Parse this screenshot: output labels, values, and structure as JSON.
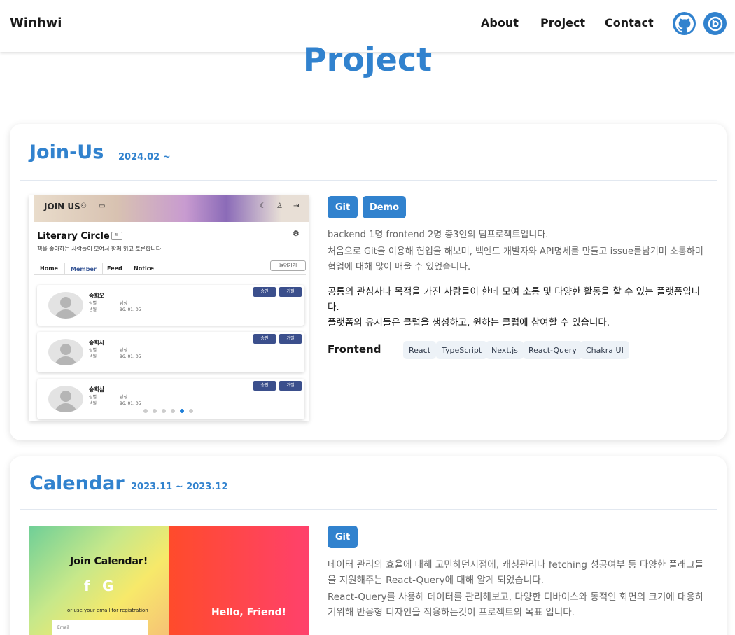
{
  "header": {
    "brand": "Winhwi",
    "nav": [
      "About",
      "Project",
      "Contact"
    ],
    "icons": [
      "github-icon",
      "blog-icon"
    ],
    "accent": "#3182ce"
  },
  "page_title": "Project",
  "projects": [
    {
      "title": "Join-Us",
      "date": "2024.02 ~",
      "buttons": [
        "Git",
        "Demo"
      ],
      "desc_gray": [
        "backend 1명 frontend 2명 총3인의 팀프로젝트입니다.",
        "처음으로 Git을 이용해 협업을 해보며, 백엔드 개발자와 API명세를 만들고 issue를남기며 소통하며 협업에 대해 많이 배울 수 있었습니다."
      ],
      "desc_dark": [
        "공통의 관심사나 목적을 가진 사람들이 한데 모여 소통 및 다양한 활동을 할 수 있는 플랫폼입니다.",
        "플랫폼의 유저들은 클럽을 생성하고, 원하는 클럽에 참여할 수 있습니다."
      ],
      "stack_label": "Frontend",
      "stack": [
        "React",
        "TypeScript",
        "Next.js",
        "React-Query",
        "Chakra UI"
      ],
      "screenshot": {
        "logo": "JOIN US",
        "title": "Literary Circle",
        "badge": "독",
        "subtitle": "책을 좋아하는 사람들이 모여서 함께 읽고 토론합니다.",
        "tabs": [
          "Home",
          "Member",
          "Feed",
          "Notice"
        ],
        "join_button": "들어가기",
        "members": [
          {
            "name": "송회오",
            "gender_label": "성별",
            "gender": "남성",
            "birth_label": "생일",
            "birth": "96. 01. 05"
          },
          {
            "name": "송회사",
            "gender_label": "성별",
            "gender": "남성",
            "birth_label": "생일",
            "birth": "96. 01. 05"
          },
          {
            "name": "송회삼",
            "gender_label": "성별",
            "gender": "남성",
            "birth_label": "생일",
            "birth": "96. 01. 05"
          }
        ],
        "approve": "승인",
        "reject": "거절",
        "carousel_active": 5,
        "carousel_total": 6
      }
    },
    {
      "title": "Calendar",
      "date": "2023.11 ~ 2023.12",
      "buttons": [
        "Git"
      ],
      "desc_gray": [
        "데이터 관리의 효율에 대해 고민하던시점에, 캐싱관리나 fetching 성공여부 등 다양한 플래그들을 지원해주는 React-Query에 대해 알게 되었습니다.",
        "React-Query를 사용해 데이터를 관리해보고, 다양한 디바이스와 동적인 화면의 크기에 대응하기위해 반응형 디자인을 적용하는것이 프로젝트의 목표 입니다."
      ],
      "screenshot": {
        "title": "Join Calendar!",
        "social": [
          "f",
          "G"
        ],
        "or_text": "or use your email for registration",
        "email_placeholder": "Email",
        "hello": "Hello, Friend!"
      }
    }
  ]
}
